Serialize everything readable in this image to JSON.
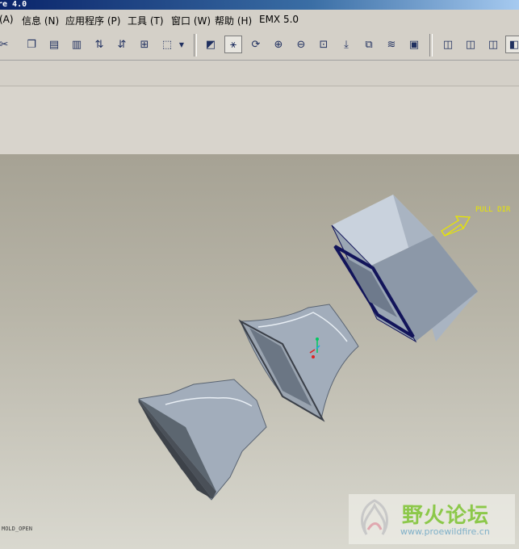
{
  "window": {
    "title": "re 4.0"
  },
  "menu": [
    {
      "label": "(A)"
    },
    {
      "label": "信息 (N)"
    },
    {
      "label": "应用程序 (P)"
    },
    {
      "label": "工具 (T)"
    },
    {
      "label": "窗口 (W)"
    },
    {
      "label": "帮助 (H)"
    },
    {
      "label": "EMX 5.0"
    }
  ],
  "toolbar": {
    "icons": [
      "cut-icon",
      "copy-icon",
      "paste-icon",
      "paste-special-icon",
      "regenerate-icon",
      "regen-manager-icon",
      "find-icon",
      "select-box-icon",
      "redraw-icon",
      "spin-center-icon",
      "orient-icon",
      "zoom-in-icon",
      "zoom-out-icon",
      "refit-icon",
      "reorient-icon",
      "saved-views-icon",
      "layers-icon",
      "view-manager-icon",
      "wireframe-icon",
      "hidden-line-icon",
      "no-hidden-icon",
      "shading-icon"
    ]
  },
  "viewport": {
    "pull_direction_label": "PULL DIR",
    "view_name": "MOLD_OPEN",
    "colors": {
      "part": "#9aa6b4",
      "edge": "#12145a",
      "arrow": "#e8e600"
    }
  },
  "watermark": {
    "title": "野火论坛",
    "url": "www.proewildfire.cn"
  }
}
